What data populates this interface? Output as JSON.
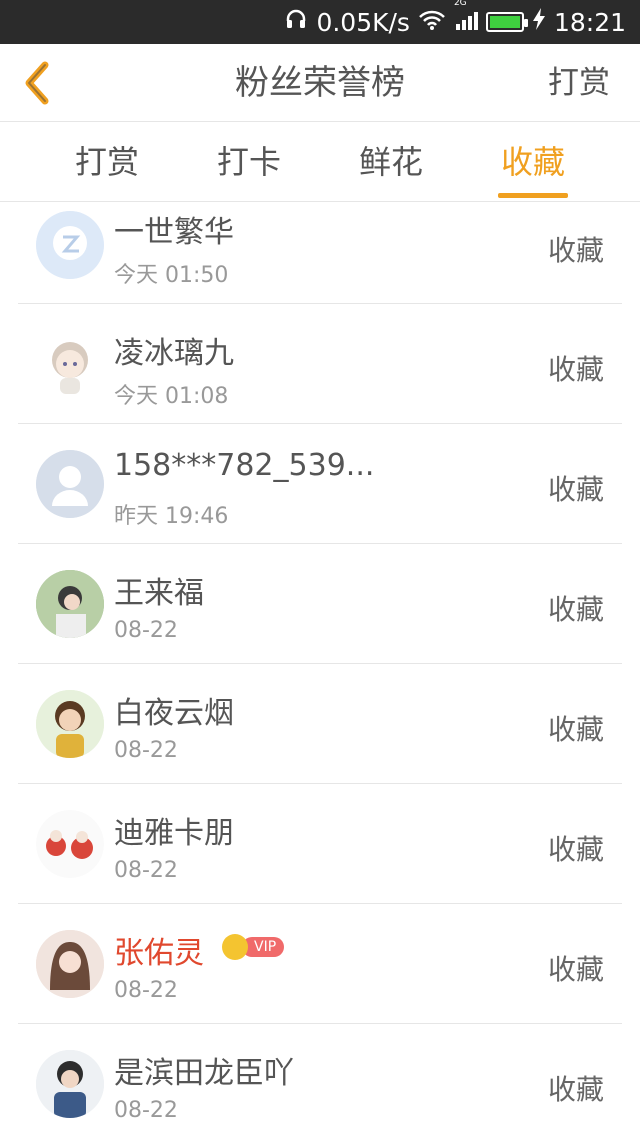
{
  "status_bar": {
    "speed": "0.05K/s",
    "network": "2G",
    "time": "18:21"
  },
  "nav": {
    "title": "粉丝荣誉榜",
    "action": "打赏"
  },
  "tabs": [
    {
      "label": "打赏"
    },
    {
      "label": "打卡"
    },
    {
      "label": "鲜花"
    },
    {
      "label": "收藏",
      "active": true
    }
  ],
  "list": [
    {
      "name": "一世繁华",
      "time": "今天 01:50",
      "action": "收藏",
      "avatar": "qq-default-avatar"
    },
    {
      "name": "凌冰璃九",
      "time": "今天 01:08",
      "action": "收藏",
      "avatar": "anime-avatar"
    },
    {
      "name": "158***782_539...",
      "time": "昨天 19:46",
      "action": "收藏",
      "avatar": "default-user-avatar"
    },
    {
      "name": "王来福",
      "time": "08-22",
      "action": "收藏",
      "avatar": "photo-avatar"
    },
    {
      "name": "白夜云烟",
      "time": "08-22",
      "action": "收藏",
      "avatar": "cartoon-avatar"
    },
    {
      "name": "迪雅卡朋",
      "time": "08-22",
      "action": "收藏",
      "avatar": "illustration-avatar"
    },
    {
      "name": "张佑灵",
      "time": "08-22",
      "action": "收藏",
      "avatar": "photo-avatar",
      "vip": "VIP"
    },
    {
      "name": "是滨田龙臣吖",
      "time": "08-22",
      "action": "收藏",
      "avatar": "photo-avatar"
    }
  ],
  "colors": {
    "accent": "#f0a020",
    "vip_name": "#e0482e",
    "status_bar": "#2b2b2b"
  }
}
